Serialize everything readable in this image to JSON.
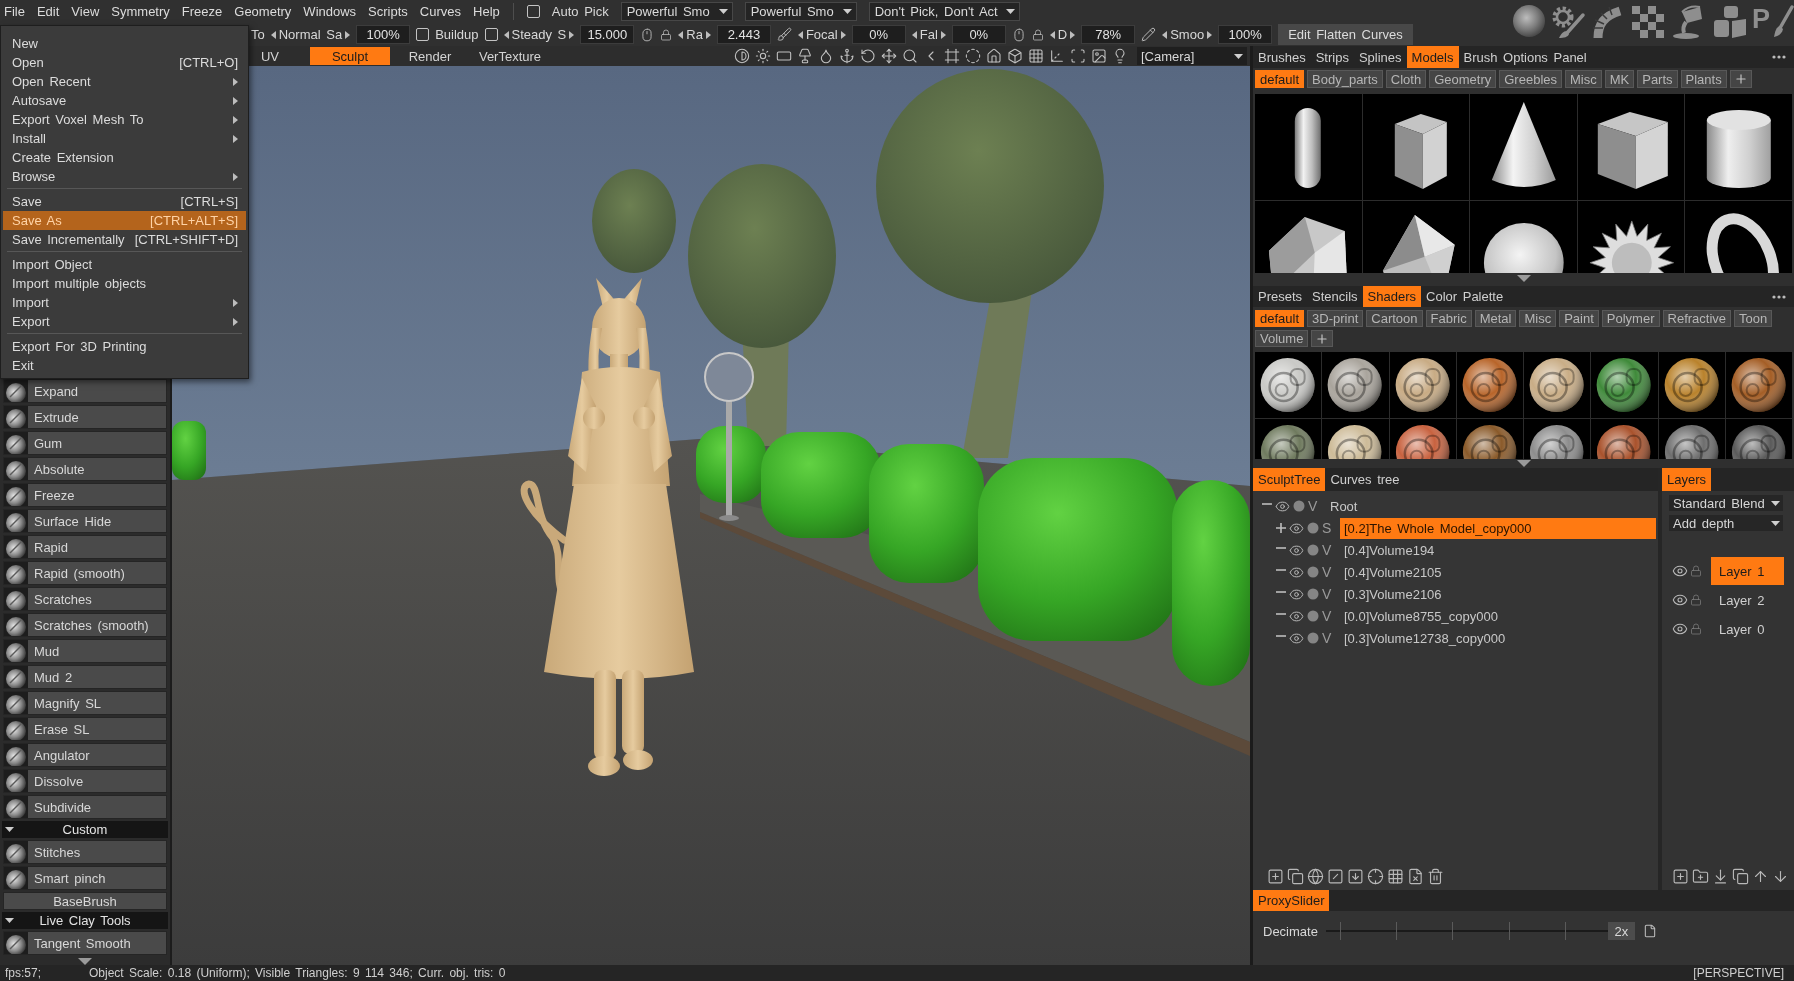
{
  "menubar": {
    "menus": [
      "File",
      "Edit",
      "View",
      "Symmetry",
      "Freeze",
      "Geometry",
      "Windows",
      "Scripts",
      "Curves",
      "Help"
    ],
    "auto_pick": {
      "label": "Auto Pick",
      "checked": false
    },
    "dropdowns": [
      "Powerful Smo",
      "Powerful Smo",
      "Don't Pick, Don't Act"
    ]
  },
  "toolbar": {
    "cut_label": "To",
    "controls": [
      {
        "kind": "stepper",
        "label": "Normal Sa",
        "value": "100%"
      },
      {
        "kind": "checkbox",
        "label": "Buildup",
        "checked": false
      },
      {
        "kind": "check_stepper",
        "label": "Steady S",
        "value": "15.000",
        "checked": false
      },
      {
        "kind": "pressure_stepper",
        "label": "Ra",
        "value": "2.443"
      },
      {
        "kind": "brush_stepper",
        "label": "Focal",
        "value": "0%"
      },
      {
        "kind": "stepper",
        "label": "Fal",
        "value": "0%"
      },
      {
        "kind": "pressure_stepper",
        "label": "D",
        "value": "78%"
      },
      {
        "kind": "pencil_stepper",
        "label": "Smoo",
        "value": "100%"
      }
    ],
    "action_button": "Edit Flatten Curves"
  },
  "room_icons": {
    "letter": "P"
  },
  "view_bar": {
    "tabs": [
      {
        "label": "UV",
        "selected": false
      },
      {
        "label": "Sculpt",
        "selected": true
      },
      {
        "label": "Render",
        "selected": false
      },
      {
        "label": "VerTexture",
        "selected": false
      }
    ],
    "camera": "[Camera]"
  },
  "file_menu": {
    "sections": [
      [
        {
          "label": "New",
          "submenu": false,
          "selected": false
        },
        {
          "label": "Open",
          "shortcut": "[CTRL+O]",
          "submenu": false,
          "selected": false
        },
        {
          "label": "Open Recent",
          "submenu": true,
          "selected": false
        },
        {
          "label": "Autosave",
          "submenu": true,
          "selected": false
        },
        {
          "label": "Export Voxel Mesh To",
          "submenu": true,
          "selected": false
        },
        {
          "label": "Install",
          "submenu": true,
          "selected": false
        },
        {
          "label": "Create Extension",
          "submenu": false,
          "selected": false
        },
        {
          "label": "Browse",
          "submenu": true,
          "selected": false
        }
      ],
      [
        {
          "label": "Save",
          "shortcut": "[CTRL+S]",
          "submenu": false,
          "selected": false
        },
        {
          "label": "Save As",
          "shortcut": "[CTRL+ALT+S]",
          "submenu": false,
          "selected": true
        },
        {
          "label": "Save Incrementally",
          "shortcut": "[CTRL+SHIFT+D]",
          "submenu": false,
          "selected": false
        }
      ],
      [
        {
          "label": "Import Object",
          "submenu": false,
          "selected": false
        },
        {
          "label": "Import multiple objects",
          "submenu": false,
          "selected": false
        },
        {
          "label": "Import",
          "submenu": true,
          "selected": false
        },
        {
          "label": "Export",
          "submenu": true,
          "selected": false
        }
      ],
      [
        {
          "label": "Export For 3D Printing",
          "submenu": false,
          "selected": false
        },
        {
          "label": "Exit",
          "submenu": false,
          "selected": false
        }
      ]
    ]
  },
  "tool_panel": {
    "items": [
      {
        "kind": "tool",
        "label": "Expand"
      },
      {
        "kind": "tool",
        "label": "Extrude"
      },
      {
        "kind": "tool",
        "label": "Gum"
      },
      {
        "kind": "tool",
        "label": "Absolute"
      },
      {
        "kind": "tool",
        "label": "Freeze"
      },
      {
        "kind": "tool",
        "label": "Surface Hide"
      },
      {
        "kind": "tool",
        "label": "Rapid"
      },
      {
        "kind": "tool",
        "label": "Rapid (smooth)"
      },
      {
        "kind": "tool",
        "label": "Scratches"
      },
      {
        "kind": "tool",
        "label": "Scratches (smooth)"
      },
      {
        "kind": "tool",
        "label": "Mud"
      },
      {
        "kind": "tool",
        "label": "Mud 2"
      },
      {
        "kind": "tool",
        "label": "Magnify SL"
      },
      {
        "kind": "tool",
        "label": "Erase SL"
      },
      {
        "kind": "tool",
        "label": "Angulator"
      },
      {
        "kind": "tool",
        "label": "Dissolve"
      },
      {
        "kind": "tool",
        "label": "Subdivide"
      },
      {
        "kind": "header",
        "label": "Custom",
        "expanded": true
      },
      {
        "kind": "tool",
        "label": "Stitches"
      },
      {
        "kind": "tool",
        "label": "Smart pinch"
      },
      {
        "kind": "button",
        "label": "BaseBrush"
      },
      {
        "kind": "header",
        "label": "Live Clay Tools",
        "expanded": true
      },
      {
        "kind": "tool",
        "label": "Tangent Smooth"
      }
    ]
  },
  "models_panel": {
    "tabs": [
      {
        "label": "Brushes",
        "selected": false
      },
      {
        "label": "Strips",
        "selected": false
      },
      {
        "label": "Splines",
        "selected": false
      },
      {
        "label": "Models",
        "selected": true
      },
      {
        "label": "Brush Options Panel",
        "selected": false
      }
    ],
    "categories": [
      {
        "label": "default",
        "selected": true
      },
      {
        "label": "Body_parts",
        "selected": false
      },
      {
        "label": "Cloth",
        "selected": false
      },
      {
        "label": "Geometry",
        "selected": false
      },
      {
        "label": "Greebles",
        "selected": false
      },
      {
        "label": "Misc",
        "selected": false
      },
      {
        "label": "MK",
        "selected": false
      },
      {
        "label": "Parts",
        "selected": false
      },
      {
        "label": "Plants",
        "selected": false
      }
    ]
  },
  "shaders_panel": {
    "tabs": [
      {
        "label": "Presets",
        "selected": false
      },
      {
        "label": "Stencils",
        "selected": false
      },
      {
        "label": "Shaders",
        "selected": true
      },
      {
        "label": "Color Palette",
        "selected": false
      }
    ],
    "categories": [
      {
        "label": "default",
        "selected": true
      },
      {
        "label": "3D-print",
        "selected": false
      },
      {
        "label": "Cartoon",
        "selected": false
      },
      {
        "label": "Fabric",
        "selected": false
      },
      {
        "label": "Metal",
        "selected": false
      },
      {
        "label": "Misc",
        "selected": false
      },
      {
        "label": "Paint",
        "selected": false
      },
      {
        "label": "Polymer",
        "selected": false
      },
      {
        "label": "Refractive",
        "selected": false
      },
      {
        "label": "Toon",
        "selected": false
      },
      {
        "label": "Volume",
        "selected": false
      }
    ]
  },
  "sculpt_tree": {
    "tabs": [
      {
        "label": "SculptTree",
        "selected": true
      },
      {
        "label": "Curves tree",
        "selected": false
      }
    ],
    "root": {
      "label": "Root",
      "type": "V",
      "expanded": true,
      "selected": false,
      "children": [
        {
          "label": "[0.2]The Whole Model_copy000",
          "type": "S",
          "expanded": false,
          "selected": true
        },
        {
          "label": "[0.4]Volume194",
          "type": "V",
          "expanded": true,
          "selected": false
        },
        {
          "label": "[0.4]Volume2105",
          "type": "V",
          "expanded": true,
          "selected": false
        },
        {
          "label": "[0.3]Volume2106",
          "type": "V",
          "expanded": true,
          "selected": false
        },
        {
          "label": "[0.0]Volume8755_copy000",
          "type": "V",
          "expanded": true,
          "selected": false
        },
        {
          "label": "[0.3]Volume12738_copy000",
          "type": "V",
          "expanded": true,
          "selected": false
        }
      ]
    }
  },
  "layers_panel": {
    "tab": {
      "label": "Layers",
      "selected": true
    },
    "blend_mode": "Standard Blend",
    "depth_mode": "Add depth",
    "layers": [
      {
        "label": "Layer 1",
        "selected": true
      },
      {
        "label": "Layer 2",
        "selected": false
      },
      {
        "label": "Layer 0",
        "selected": false
      }
    ]
  },
  "proxy_slider": {
    "tab": {
      "label": "ProxySlider",
      "selected": true
    },
    "label": "Decimate",
    "value": "2x",
    "level": 1
  },
  "status_bar": {
    "fps": "fps:57;",
    "info": "Object Scale: 0.18 (Uniform); Visible Triangles: 9 114 346; Curr. obj. tris: 0",
    "projection": "[PERSPECTIVE]"
  }
}
